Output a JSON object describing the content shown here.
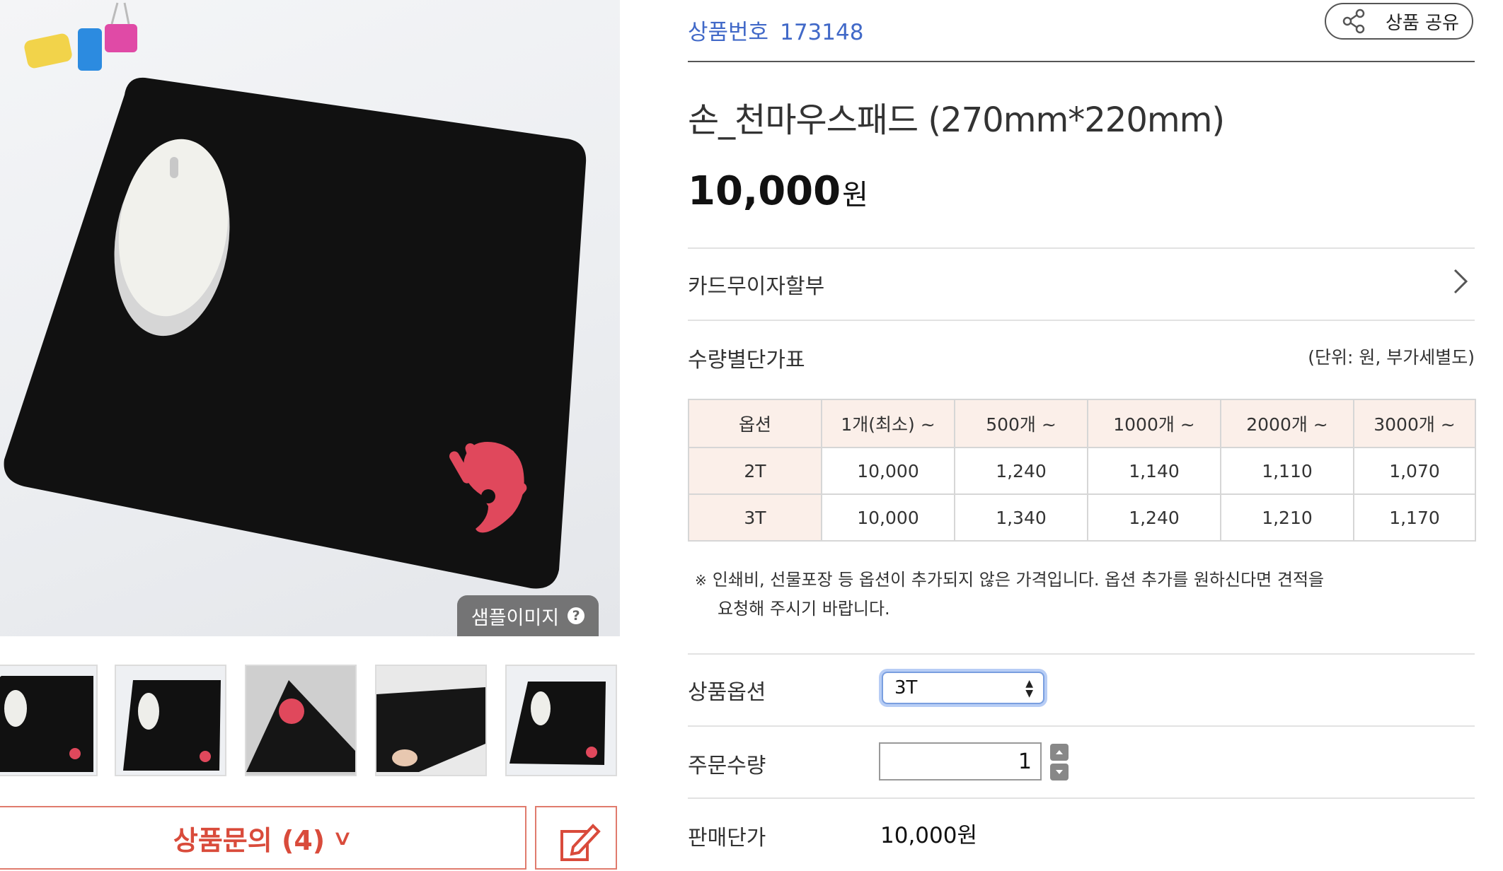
{
  "product": {
    "code_label": "상품번호",
    "code_value": "173148",
    "share_label": "상품 공유",
    "title": "손_천마우스패드 (270mm*220mm)",
    "price_number": "10,000",
    "price_unit": "원",
    "installment_label": "카드무이자할부"
  },
  "gallery": {
    "sample_label": "샘플이미지",
    "help_glyph": "?",
    "thumbnails": [
      "thumbnail-1",
      "thumbnail-2",
      "thumbnail-3",
      "thumbnail-4",
      "thumbnail-5"
    ],
    "inquiry_label": "상품문의 (4)",
    "inquiry_chevron": "∨"
  },
  "quantity_table": {
    "title": "수량별단가표",
    "unit_note": "(단위: 원,  부가세별도)",
    "headers": [
      "옵션",
      "1개(최소) ~",
      "500개 ~",
      "1000개 ~",
      "2000개 ~",
      "3000개 ~"
    ],
    "rows": [
      [
        "2T",
        "10,000",
        "1,240",
        "1,140",
        "1,110",
        "1,070"
      ],
      [
        "3T",
        "10,000",
        "1,340",
        "1,240",
        "1,210",
        "1,170"
      ]
    ]
  },
  "note": {
    "mark": "※",
    "line1": "인쇄비, 선물포장 등 옵션이 추가되지 않은 가격입니다.   옵션 추가를 원하신다면 견적을",
    "line2": "요청해 주시기 바랍니다."
  },
  "order": {
    "option_label": "상품옵션",
    "option_value": "3T",
    "quantity_label": "주문수량",
    "quantity_value": "1",
    "unit_price_label": "판매단가",
    "unit_price_value": "10,000원"
  },
  "colors": {
    "accent_blue": "#4169c8",
    "accent_red": "#d94b3b",
    "table_header_bg": "#fbefe9"
  },
  "icons": {
    "share": "share-icon",
    "chevron": "chevron-right-icon",
    "help": "help-icon",
    "edit": "edit-icon"
  }
}
